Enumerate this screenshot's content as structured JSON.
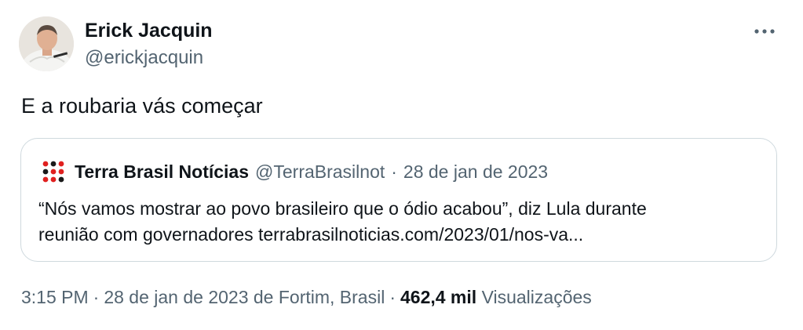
{
  "author": {
    "name": "Erick Jacquin",
    "handle": "@erickjacquin"
  },
  "tweet": {
    "text": "E a roubaria vás começar"
  },
  "quoted_tweet": {
    "source_name": "Terra Brasil Notícias",
    "source_handle": "@TerraBrasilnot",
    "separator": "·",
    "date": "28 de jan de 2023",
    "text_line1": "“Nós vamos mostrar ao povo brasileiro que o ódio acabou”, diz Lula durante",
    "text_line2": "reunião com governadores terrabrasilnoticias.com/2023/01/nos-va..."
  },
  "meta": {
    "time": "3:15 PM",
    "separator": "·",
    "date_location": "28 de jan de 2023 de Fortim, Brasil",
    "views_count": "462,4 mil",
    "views_label": "Visualizações"
  },
  "icons": {
    "more": "more-options-icon",
    "source_logo": "terra-logo-icon",
    "accent_color": "#e0201f",
    "secondary_text_color": "#536471",
    "border_color": "#cfd9de"
  }
}
